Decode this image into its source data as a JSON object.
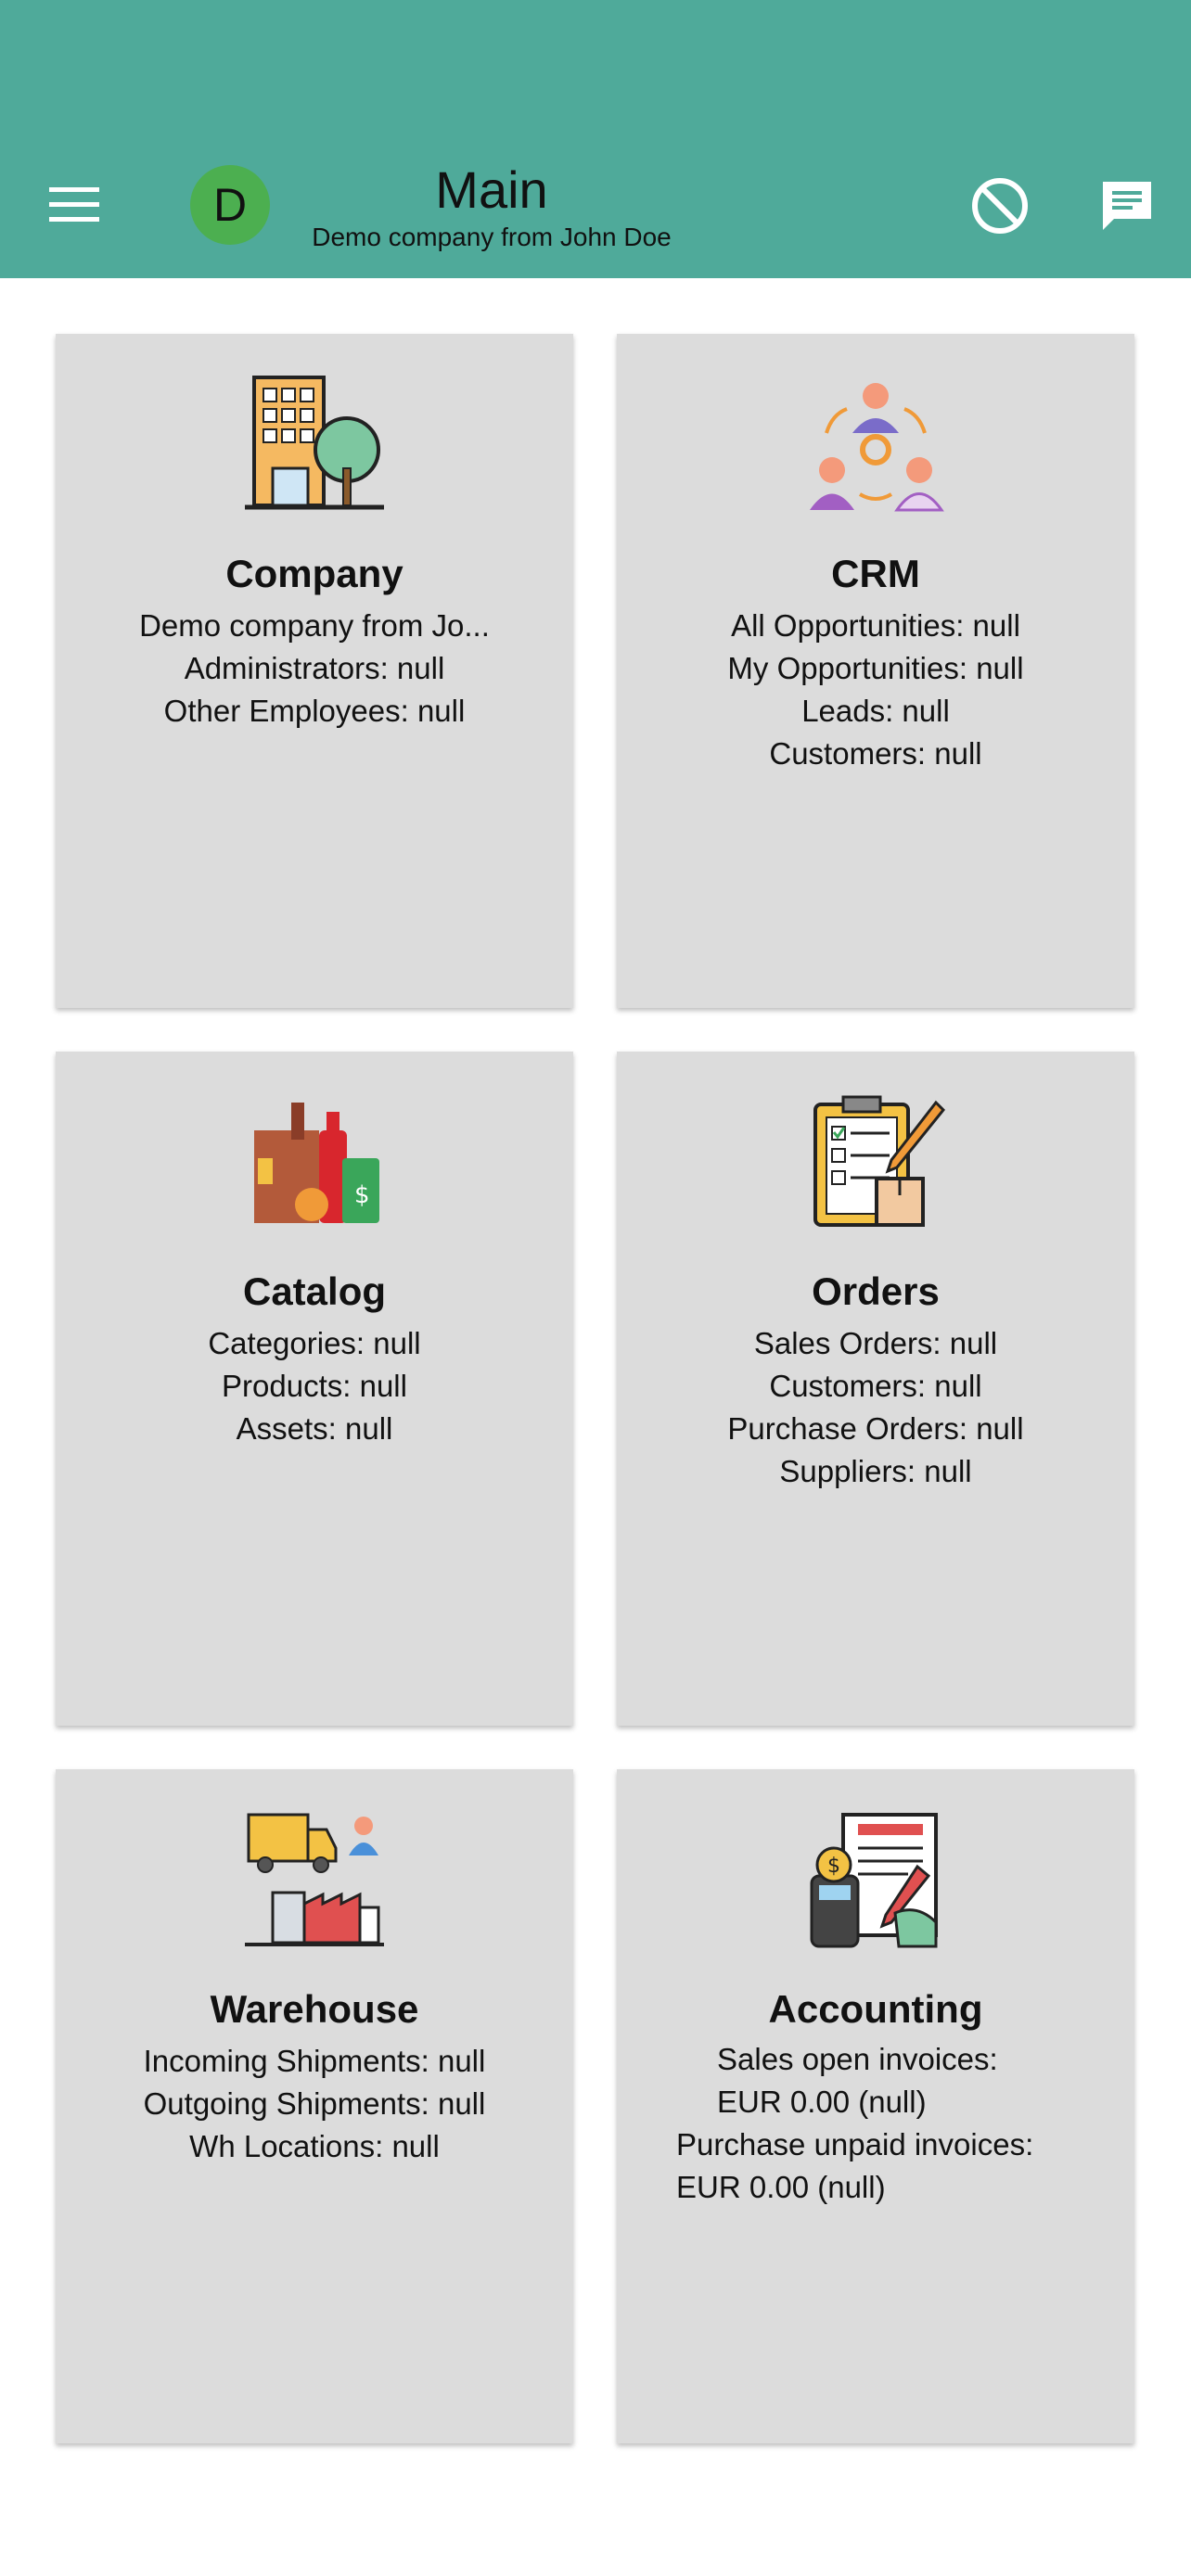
{
  "appbar": {
    "title": "Main",
    "subtitle": "Demo company from John Doe",
    "avatar_letter": "D",
    "menu_icon": "menu-icon",
    "actions": [
      "block-icon",
      "chat-icon"
    ],
    "color": "#4faa9a"
  },
  "cards": [
    {
      "title": "Company",
      "icon": "company-building-icon",
      "lines": [
        "Demo company from Jo...",
        "Administrators: null",
        "Other Employees: null"
      ]
    },
    {
      "title": "CRM",
      "icon": "crm-people-icon",
      "lines": [
        "All Opportunities: null",
        "My Opportunities: null",
        "Leads: null",
        "Customers: null"
      ]
    },
    {
      "title": "Catalog",
      "icon": "catalog-products-icon",
      "lines": [
        "Categories: null",
        "Products: null",
        "Assets: null"
      ]
    },
    {
      "title": "Orders",
      "icon": "orders-clipboard-icon",
      "lines": [
        "Sales Orders: null",
        "Customers: null",
        "Purchase Orders: null",
        "Suppliers: null"
      ]
    },
    {
      "title": "Warehouse",
      "icon": "warehouse-truck-icon",
      "lines": [
        "Incoming Shipments: null",
        "Outgoing Shipments: null",
        "Wh Locations: null"
      ]
    },
    {
      "title": "Accounting",
      "icon": "accounting-invoice-icon",
      "lines": [
        "Sales open invoices:",
        "EUR 0.00 (null)",
        "Purchase unpaid invoices:",
        "EUR 0.00 (null)"
      ]
    }
  ],
  "colors": {
    "card_bg": "#dcdcdc",
    "avatar_bg": "#4caf50"
  }
}
